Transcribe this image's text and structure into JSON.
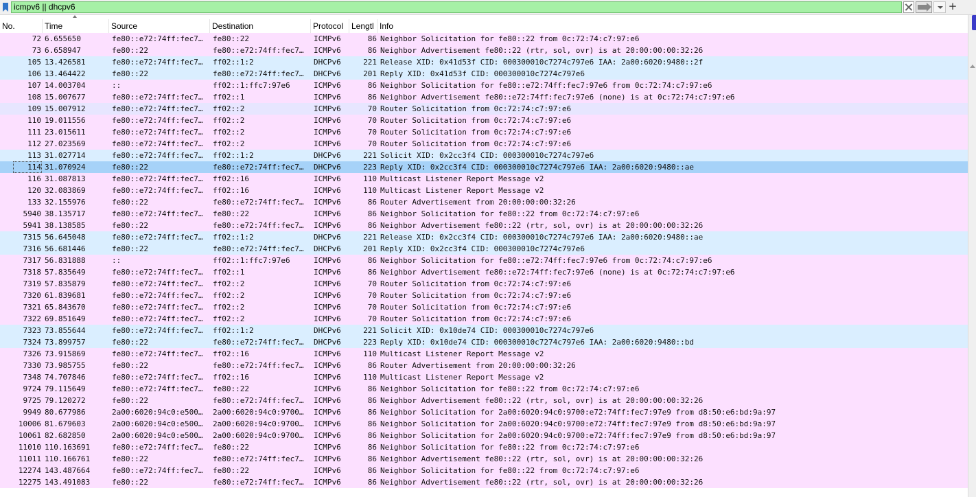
{
  "filter": {
    "value": "icmpv6 || dhcpv6"
  },
  "toolbar": {
    "plus_label": "+"
  },
  "columns": [
    "No.",
    "Time",
    "Source",
    "Destination",
    "Protocol",
    "Lengtl",
    "Info"
  ],
  "packets": [
    {
      "no": "72",
      "time": "6.655650",
      "src": "fe80::e72:74ff:fec7…",
      "dst": "fe80::22",
      "proto": "ICMPv6",
      "len": "86",
      "info": "Neighbor Solicitation for fe80::22 from 0c:72:74:c7:97:e6",
      "kind": "icmp"
    },
    {
      "no": "73",
      "time": "6.658947",
      "src": "fe80::22",
      "dst": "fe80::e72:74ff:fec7…",
      "proto": "ICMPv6",
      "len": "86",
      "info": "Neighbor Advertisement fe80::22 (rtr, sol, ovr) is at 20:00:00:00:32:26",
      "kind": "icmp"
    },
    {
      "no": "105",
      "time": "13.426581",
      "src": "fe80::e72:74ff:fec7…",
      "dst": "ff02::1:2",
      "proto": "DHCPv6",
      "len": "221",
      "info": "Release XID: 0x41d53f CID: 000300010c7274c797e6 IAA: 2a00:6020:9480::2f",
      "kind": "dhcp"
    },
    {
      "no": "106",
      "time": "13.464422",
      "src": "fe80::22",
      "dst": "fe80::e72:74ff:fec7…",
      "proto": "DHCPv6",
      "len": "201",
      "info": "Reply XID: 0x41d53f CID: 000300010c7274c797e6",
      "kind": "dhcp"
    },
    {
      "no": "107",
      "time": "14.003704",
      "src": "::",
      "dst": "ff02::1:ffc7:97e6",
      "proto": "ICMPv6",
      "len": "86",
      "info": "Neighbor Solicitation for fe80::e72:74ff:fec7:97e6 from 0c:72:74:c7:97:e6",
      "kind": "icmp"
    },
    {
      "no": "108",
      "time": "15.007677",
      "src": "fe80::e72:74ff:fec7…",
      "dst": "ff02::1",
      "proto": "ICMPv6",
      "len": "86",
      "info": "Neighbor Advertisement fe80::e72:74ff:fec7:97e6 (none) is at 0c:72:74:c7:97:e6",
      "kind": "icmp"
    },
    {
      "no": "109",
      "time": "15.007912",
      "src": "fe80::e72:74ff:fec7…",
      "dst": "ff02::2",
      "proto": "ICMPv6",
      "len": "70",
      "info": "Router Solicitation from 0c:72:74:c7:97:e6",
      "kind": "router"
    },
    {
      "no": "110",
      "time": "19.011556",
      "src": "fe80::e72:74ff:fec7…",
      "dst": "ff02::2",
      "proto": "ICMPv6",
      "len": "70",
      "info": "Router Solicitation from 0c:72:74:c7:97:e6",
      "kind": "icmp"
    },
    {
      "no": "111",
      "time": "23.015611",
      "src": "fe80::e72:74ff:fec7…",
      "dst": "ff02::2",
      "proto": "ICMPv6",
      "len": "70",
      "info": "Router Solicitation from 0c:72:74:c7:97:e6",
      "kind": "icmp"
    },
    {
      "no": "112",
      "time": "27.023569",
      "src": "fe80::e72:74ff:fec7…",
      "dst": "ff02::2",
      "proto": "ICMPv6",
      "len": "70",
      "info": "Router Solicitation from 0c:72:74:c7:97:e6",
      "kind": "icmp"
    },
    {
      "no": "113",
      "time": "31.027714",
      "src": "fe80::e72:74ff:fec7…",
      "dst": "ff02::1:2",
      "proto": "DHCPv6",
      "len": "221",
      "info": "Solicit XID: 0x2cc3f4 CID: 000300010c7274c797e6",
      "kind": "dhcp"
    },
    {
      "no": "114",
      "time": "31.070924",
      "src": "fe80::22",
      "dst": "fe80::e72:74ff:fec7…",
      "proto": "DHCPv6",
      "len": "223",
      "info": "Reply XID: 0x2cc3f4 CID: 000300010c7274c797e6 IAA: 2a00:6020:9480::ae",
      "kind": "selected"
    },
    {
      "no": "116",
      "time": "31.087813",
      "src": "fe80::e72:74ff:fec7…",
      "dst": "ff02::16",
      "proto": "ICMPv6",
      "len": "110",
      "info": "Multicast Listener Report Message v2",
      "kind": "icmp"
    },
    {
      "no": "120",
      "time": "32.083869",
      "src": "fe80::e72:74ff:fec7…",
      "dst": "ff02::16",
      "proto": "ICMPv6",
      "len": "110",
      "info": "Multicast Listener Report Message v2",
      "kind": "icmp"
    },
    {
      "no": "133",
      "time": "32.155976",
      "src": "fe80::22",
      "dst": "fe80::e72:74ff:fec7…",
      "proto": "ICMPv6",
      "len": "86",
      "info": "Router Advertisement from 20:00:00:00:32:26",
      "kind": "icmp"
    },
    {
      "no": "5940",
      "time": "38.135717",
      "src": "fe80::e72:74ff:fec7…",
      "dst": "fe80::22",
      "proto": "ICMPv6",
      "len": "86",
      "info": "Neighbor Solicitation for fe80::22 from 0c:72:74:c7:97:e6",
      "kind": "icmp"
    },
    {
      "no": "5941",
      "time": "38.138585",
      "src": "fe80::22",
      "dst": "fe80::e72:74ff:fec7…",
      "proto": "ICMPv6",
      "len": "86",
      "info": "Neighbor Advertisement fe80::22 (rtr, sol, ovr) is at 20:00:00:00:32:26",
      "kind": "icmp"
    },
    {
      "no": "7315",
      "time": "56.645048",
      "src": "fe80::e72:74ff:fec7…",
      "dst": "ff02::1:2",
      "proto": "DHCPv6",
      "len": "221",
      "info": "Release XID: 0x2cc3f4 CID: 000300010c7274c797e6 IAA: 2a00:6020:9480::ae",
      "kind": "dhcp"
    },
    {
      "no": "7316",
      "time": "56.681446",
      "src": "fe80::22",
      "dst": "fe80::e72:74ff:fec7…",
      "proto": "DHCPv6",
      "len": "201",
      "info": "Reply XID: 0x2cc3f4 CID: 000300010c7274c797e6",
      "kind": "dhcp"
    },
    {
      "no": "7317",
      "time": "56.831888",
      "src": "::",
      "dst": "ff02::1:ffc7:97e6",
      "proto": "ICMPv6",
      "len": "86",
      "info": "Neighbor Solicitation for fe80::e72:74ff:fec7:97e6 from 0c:72:74:c7:97:e6",
      "kind": "icmp"
    },
    {
      "no": "7318",
      "time": "57.835649",
      "src": "fe80::e72:74ff:fec7…",
      "dst": "ff02::1",
      "proto": "ICMPv6",
      "len": "86",
      "info": "Neighbor Advertisement fe80::e72:74ff:fec7:97e6 (none) is at 0c:72:74:c7:97:e6",
      "kind": "icmp"
    },
    {
      "no": "7319",
      "time": "57.835879",
      "src": "fe80::e72:74ff:fec7…",
      "dst": "ff02::2",
      "proto": "ICMPv6",
      "len": "70",
      "info": "Router Solicitation from 0c:72:74:c7:97:e6",
      "kind": "icmp"
    },
    {
      "no": "7320",
      "time": "61.839681",
      "src": "fe80::e72:74ff:fec7…",
      "dst": "ff02::2",
      "proto": "ICMPv6",
      "len": "70",
      "info": "Router Solicitation from 0c:72:74:c7:97:e6",
      "kind": "icmp"
    },
    {
      "no": "7321",
      "time": "65.843670",
      "src": "fe80::e72:74ff:fec7…",
      "dst": "ff02::2",
      "proto": "ICMPv6",
      "len": "70",
      "info": "Router Solicitation from 0c:72:74:c7:97:e6",
      "kind": "icmp"
    },
    {
      "no": "7322",
      "time": "69.851649",
      "src": "fe80::e72:74ff:fec7…",
      "dst": "ff02::2",
      "proto": "ICMPv6",
      "len": "70",
      "info": "Router Solicitation from 0c:72:74:c7:97:e6",
      "kind": "icmp"
    },
    {
      "no": "7323",
      "time": "73.855644",
      "src": "fe80::e72:74ff:fec7…",
      "dst": "ff02::1:2",
      "proto": "DHCPv6",
      "len": "221",
      "info": "Solicit XID: 0x10de74 CID: 000300010c7274c797e6",
      "kind": "dhcp"
    },
    {
      "no": "7324",
      "time": "73.899757",
      "src": "fe80::22",
      "dst": "fe80::e72:74ff:fec7…",
      "proto": "DHCPv6",
      "len": "223",
      "info": "Reply XID: 0x10de74 CID: 000300010c7274c797e6 IAA: 2a00:6020:9480::bd",
      "kind": "dhcp"
    },
    {
      "no": "7326",
      "time": "73.915869",
      "src": "fe80::e72:74ff:fec7…",
      "dst": "ff02::16",
      "proto": "ICMPv6",
      "len": "110",
      "info": "Multicast Listener Report Message v2",
      "kind": "icmp"
    },
    {
      "no": "7330",
      "time": "73.985755",
      "src": "fe80::22",
      "dst": "fe80::e72:74ff:fec7…",
      "proto": "ICMPv6",
      "len": "86",
      "info": "Router Advertisement from 20:00:00:00:32:26",
      "kind": "icmp"
    },
    {
      "no": "7348",
      "time": "74.707846",
      "src": "fe80::e72:74ff:fec7…",
      "dst": "ff02::16",
      "proto": "ICMPv6",
      "len": "110",
      "info": "Multicast Listener Report Message v2",
      "kind": "icmp"
    },
    {
      "no": "9724",
      "time": "79.115649",
      "src": "fe80::e72:74ff:fec7…",
      "dst": "fe80::22",
      "proto": "ICMPv6",
      "len": "86",
      "info": "Neighbor Solicitation for fe80::22 from 0c:72:74:c7:97:e6",
      "kind": "icmp"
    },
    {
      "no": "9725",
      "time": "79.120272",
      "src": "fe80::22",
      "dst": "fe80::e72:74ff:fec7…",
      "proto": "ICMPv6",
      "len": "86",
      "info": "Neighbor Advertisement fe80::22 (rtr, sol, ovr) is at 20:00:00:00:32:26",
      "kind": "icmp"
    },
    {
      "no": "9949",
      "time": "80.677986",
      "src": "2a00:6020:94c0:e500…",
      "dst": "2a00:6020:94c0:9700…",
      "proto": "ICMPv6",
      "len": "86",
      "info": "Neighbor Solicitation for 2a00:6020:94c0:9700:e72:74ff:fec7:97e9 from d8:50:e6:bd:9a:97",
      "kind": "icmp"
    },
    {
      "no": "10006",
      "time": "81.679603",
      "src": "2a00:6020:94c0:e500…",
      "dst": "2a00:6020:94c0:9700…",
      "proto": "ICMPv6",
      "len": "86",
      "info": "Neighbor Solicitation for 2a00:6020:94c0:9700:e72:74ff:fec7:97e9 from d8:50:e6:bd:9a:97",
      "kind": "icmp"
    },
    {
      "no": "10061",
      "time": "82.682850",
      "src": "2a00:6020:94c0:e500…",
      "dst": "2a00:6020:94c0:9700…",
      "proto": "ICMPv6",
      "len": "86",
      "info": "Neighbor Solicitation for 2a00:6020:94c0:9700:e72:74ff:fec7:97e9 from d8:50:e6:bd:9a:97",
      "kind": "icmp"
    },
    {
      "no": "11010",
      "time": "110.163691",
      "src": "fe80::e72:74ff:fec7…",
      "dst": "fe80::22",
      "proto": "ICMPv6",
      "len": "86",
      "info": "Neighbor Solicitation for fe80::22 from 0c:72:74:c7:97:e6",
      "kind": "icmp"
    },
    {
      "no": "11011",
      "time": "110.166761",
      "src": "fe80::22",
      "dst": "fe80::e72:74ff:fec7…",
      "proto": "ICMPv6",
      "len": "86",
      "info": "Neighbor Advertisement fe80::22 (rtr, sol, ovr) is at 20:00:00:00:32:26",
      "kind": "icmp"
    },
    {
      "no": "12274",
      "time": "143.487664",
      "src": "fe80::e72:74ff:fec7…",
      "dst": "fe80::22",
      "proto": "ICMPv6",
      "len": "86",
      "info": "Neighbor Solicitation for fe80::22 from 0c:72:74:c7:97:e6",
      "kind": "icmp"
    },
    {
      "no": "12275",
      "time": "143.491083",
      "src": "fe80::22",
      "dst": "fe80::e72:74ff:fec7…",
      "proto": "ICMPv6",
      "len": "86",
      "info": "Neighbor Advertisement fe80::22 (rtr, sol, ovr) is at 20:00:00:00:32:26",
      "kind": "icmp"
    }
  ]
}
